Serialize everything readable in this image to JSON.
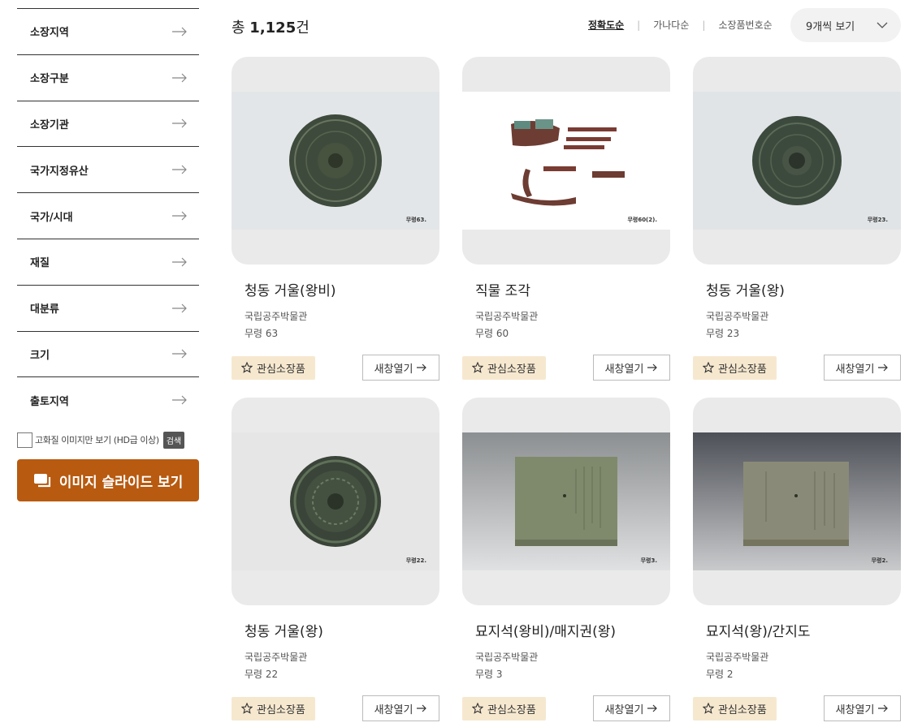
{
  "sidebar": {
    "filters": [
      {
        "label": "소장지역"
      },
      {
        "label": "소장구분"
      },
      {
        "label": "소장기관"
      },
      {
        "label": "국가지정유산"
      },
      {
        "label": "국가/시대"
      },
      {
        "label": "재질"
      },
      {
        "label": "대분류"
      },
      {
        "label": "크기"
      },
      {
        "label": "출토지역"
      }
    ],
    "hd_label": "고화질 이미지만 보기 (HD급 이상)",
    "search_label": "검색",
    "slide_label": "이미지 슬라이드 보기"
  },
  "header": {
    "total_prefix": "총",
    "total_count": "1,125",
    "total_suffix": "건",
    "sort_options": [
      "정확도순",
      "가나다순",
      "소장품번호순"
    ],
    "sort_separator": "|",
    "view_select": "9개씩 보기"
  },
  "cards": [
    {
      "title": "청동 거울(왕비)",
      "museum": "국립공주박물관",
      "id": "무령 63",
      "photo_tag": "무령63.",
      "fav_label": "관심소장품",
      "open_label": "새창열기"
    },
    {
      "title": "직물 조각",
      "museum": "국립공주박물관",
      "id": "무령 60",
      "photo_tag": "무령60(2).",
      "fav_label": "관심소장품",
      "open_label": "새창열기"
    },
    {
      "title": "청동 거울(왕)",
      "museum": "국립공주박물관",
      "id": "무령 23",
      "photo_tag": "무령23.",
      "fav_label": "관심소장품",
      "open_label": "새창열기"
    },
    {
      "title": "청동 거울(왕)",
      "museum": "국립공주박물관",
      "id": "무령 22",
      "photo_tag": "무령22.",
      "fav_label": "관심소장품",
      "open_label": "새창열기"
    },
    {
      "title": "묘지석(왕비)/매지권(왕)",
      "museum": "국립공주박물관",
      "id": "무령 3",
      "photo_tag": "무령3.",
      "fav_label": "관심소장품",
      "open_label": "새창열기"
    },
    {
      "title": "묘지석(왕)/간지도",
      "museum": "국립공주박물관",
      "id": "무령 2",
      "photo_tag": "무령2.",
      "fav_label": "관심소장품",
      "open_label": "새창열기"
    }
  ],
  "colors": {
    "accent": "#b85a10",
    "fav_bg": "#f6e8cf"
  }
}
